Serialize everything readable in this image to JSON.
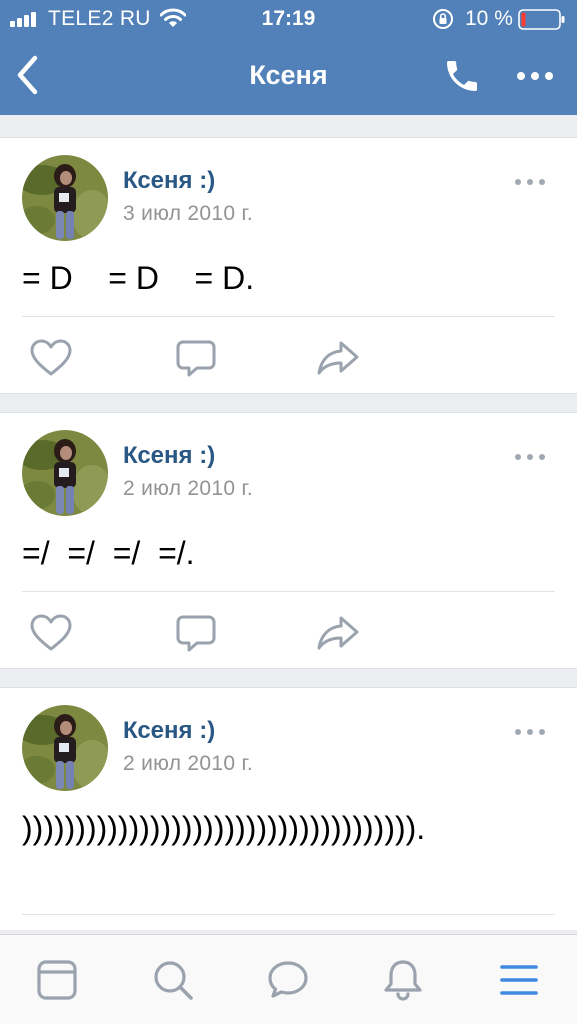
{
  "status_bar": {
    "carrier": "TELE2 RU",
    "time": "17:19",
    "battery": "10 %",
    "icons": [
      "signal-icon",
      "wifi-icon",
      "orientation-lock-icon",
      "battery-icon"
    ]
  },
  "header": {
    "title": "Ксеня",
    "icons": [
      "back-chevron-icon",
      "phone-icon",
      "more-horizontal-icon"
    ]
  },
  "posts": [
    {
      "author": "Ксеня :)",
      "date": "3 июл 2010 г.",
      "text": "= D    = D    = D."
    },
    {
      "author": "Ксеня :)",
      "date": "2 июл 2010 г.",
      "text": "=/  =/  =/  =/."
    },
    {
      "author": "Ксеня :)",
      "date": "2 июл 2010 г.",
      "text": "))))))))))))))))))))))))))))))))))))).",
      "icons": []
    }
  ],
  "post_actions": [
    "like-icon",
    "comment-icon",
    "share-icon"
  ],
  "tabbar": {
    "tabs": [
      "news-icon",
      "search-icon",
      "messages-icon",
      "notifications-icon",
      "menu-icon"
    ],
    "active_tab": "menu-icon"
  },
  "colors": {
    "header_bg": "#5181b8",
    "author_link": "#2a5885",
    "date_gray": "#939393",
    "icon_gray": "#99a2ad",
    "active_tab": "#3f8ae0",
    "battery_low": "#ff3b30"
  }
}
